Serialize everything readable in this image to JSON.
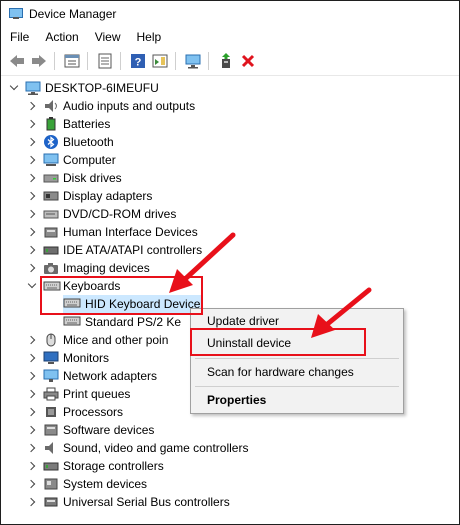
{
  "window": {
    "title": "Device Manager"
  },
  "menu": [
    "File",
    "Action",
    "View",
    "Help"
  ],
  "toolbar": {
    "buttons": [
      "back-icon",
      "forward-icon",
      "properties-icon",
      "show-hidden-icon",
      "help-icon",
      "action-pane-icon",
      "monitor-icon",
      "update-driver-icon",
      "uninstall-icon"
    ]
  },
  "tree": {
    "root": "DESKTOP-6IMEUFU",
    "categories": [
      {
        "label": "Audio inputs and outputs",
        "icon": "speaker-icon"
      },
      {
        "label": "Batteries",
        "icon": "battery-icon"
      },
      {
        "label": "Bluetooth",
        "icon": "bluetooth-icon"
      },
      {
        "label": "Computer",
        "icon": "computer-icon"
      },
      {
        "label": "Disk drives",
        "icon": "disk-drive-icon"
      },
      {
        "label": "Display adapters",
        "icon": "display-adapter-icon"
      },
      {
        "label": "DVD/CD-ROM drives",
        "icon": "dvd-icon"
      },
      {
        "label": "Human Interface Devices",
        "icon": "hid-icon"
      },
      {
        "label": "IDE ATA/ATAPI controllers",
        "icon": "ide-icon"
      },
      {
        "label": "Imaging devices",
        "icon": "camera-icon"
      },
      {
        "label": "Keyboards",
        "icon": "keyboard-icon",
        "expanded": true,
        "children": [
          {
            "label": "HID Keyboard Device",
            "selected": true
          },
          {
            "label": "Standard PS/2 Ke"
          }
        ]
      },
      {
        "label": "Mice and other poin",
        "icon": "mouse-icon"
      },
      {
        "label": "Monitors",
        "icon": "monitor-icon"
      },
      {
        "label": "Network adapters",
        "icon": "network-icon"
      },
      {
        "label": "Print queues",
        "icon": "printer-icon"
      },
      {
        "label": "Processors",
        "icon": "processor-icon"
      },
      {
        "label": "Software devices",
        "icon": "software-device-icon"
      },
      {
        "label": "Sound, video and game controllers",
        "icon": "sound-icon"
      },
      {
        "label": "Storage controllers",
        "icon": "storage-icon"
      },
      {
        "label": "System devices",
        "icon": "system-icon"
      },
      {
        "label": "Universal Serial Bus controllers",
        "icon": "usb-icon"
      }
    ]
  },
  "context_menu": {
    "items": [
      "Update driver",
      "Uninstall device",
      "Scan for hardware changes",
      "Properties"
    ]
  },
  "colors": {
    "highlight_red": "#e8101a",
    "selection_bg": "#cce8ff"
  }
}
